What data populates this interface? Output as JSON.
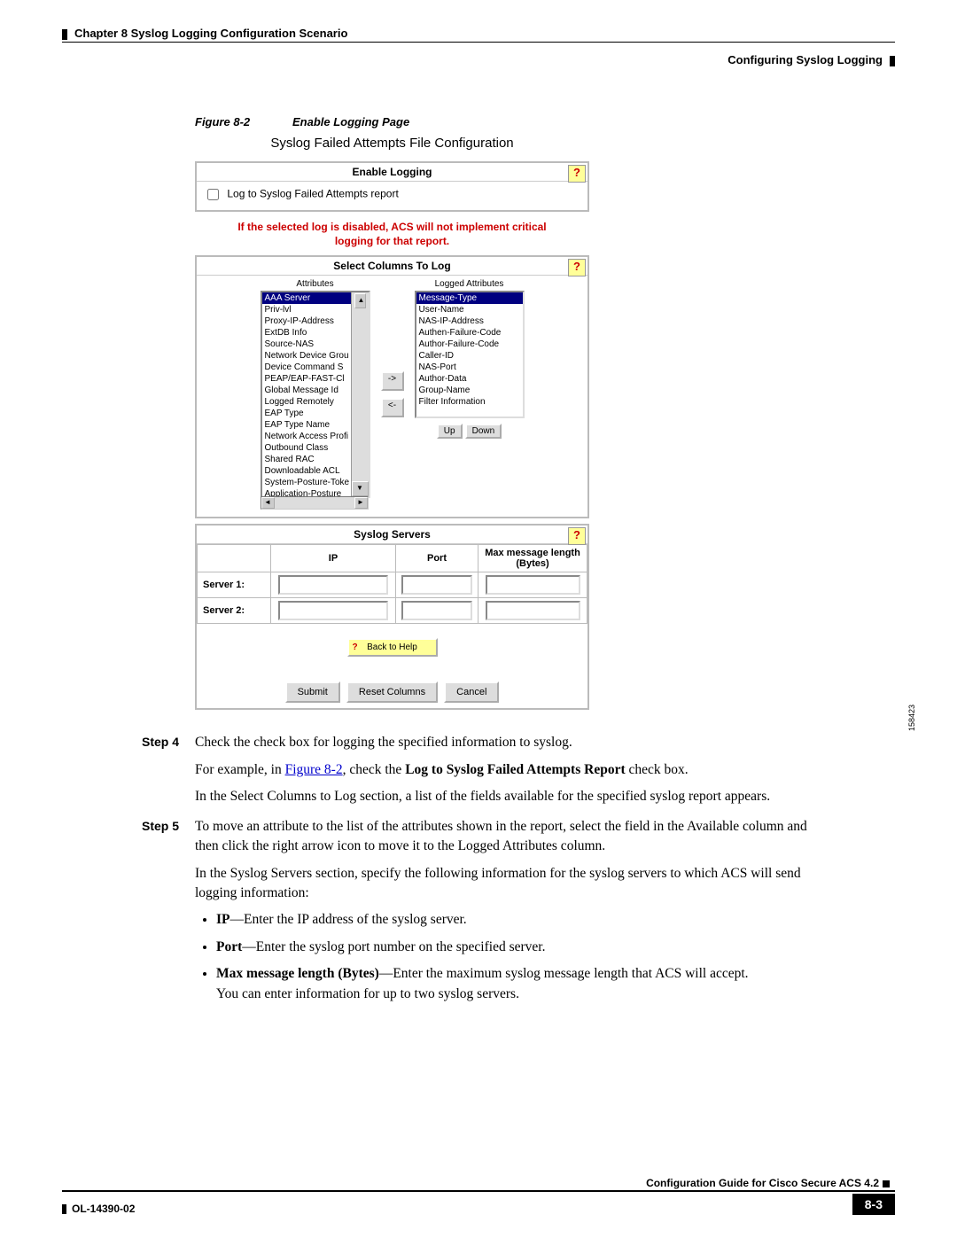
{
  "header": {
    "chapter": "Chapter 8      Syslog Logging Configuration Scenario",
    "section": "Configuring Syslog Logging"
  },
  "figure": {
    "num": "Figure 8-2",
    "title": "Enable Logging Page",
    "id": "158423"
  },
  "screenshot": {
    "title": "Syslog Failed Attempts File Configuration",
    "enable_logging": {
      "header": "Enable Logging",
      "checkbox_label": "Log to Syslog Failed Attempts report",
      "warning": "If the selected log is disabled, ACS will not implement critical logging for that report."
    },
    "select_columns": {
      "header": "Select Columns To Log",
      "attributes_label": "Attributes",
      "logged_label": "Logged Attributes",
      "attributes": [
        "AAA Server",
        "Priv-lvl",
        "Proxy-IP-Address",
        "ExtDB Info",
        "Source-NAS",
        "Network Device Grou",
        "Device Command S",
        "PEAP/EAP-FAST-Cl",
        "Global Message Id",
        "Logged Remotely",
        "EAP Type",
        "EAP Type Name",
        "Network Access Profi",
        "Outbound Class",
        "Shared RAC",
        "Downloadable ACL",
        "System-Posture-Toke",
        "Application-Posture"
      ],
      "logged": [
        "Message-Type",
        "User-Name",
        "NAS-IP-Address",
        "Authen-Failure-Code",
        "Author-Failure-Code",
        "Caller-ID",
        "NAS-Port",
        "Author-Data",
        "Group-Name",
        "Filter Information"
      ],
      "move_right": "->",
      "move_left": "<-",
      "up": "Up",
      "down": "Down"
    },
    "servers": {
      "header": "Syslog Servers",
      "cols": {
        "ip": "IP",
        "port": "Port",
        "max": "Max message length (Bytes)"
      },
      "rows": [
        "Server 1:",
        "Server 2:"
      ]
    },
    "back_help": "Back to Help",
    "buttons": {
      "submit": "Submit",
      "reset": "Reset Columns",
      "cancel": "Cancel"
    }
  },
  "steps": {
    "s4": {
      "label": "Step 4",
      "p1": "Check the check box for logging the specified information to syslog.",
      "p2a": "For example, in ",
      "p2link": "Figure 8-2",
      "p2b": ", check the ",
      "p2bold": "Log to Syslog Failed Attempts Report",
      "p2c": " check box.",
      "p3": "In the Select Columns to Log section, a list of the fields available for the specified syslog report appears."
    },
    "s5": {
      "label": "Step 5",
      "p1": "To move an attribute to the list of the attributes shown in the report, select the field in the Available column and then click the right arrow icon to move it to the Logged Attributes column.",
      "p2": "In the Syslog Servers section, specify the following information for the syslog servers to which ACS will send logging information:",
      "b1a": "IP",
      "b1b": "—Enter the IP address of the syslog server.",
      "b2a": "Port",
      "b2b": "—Enter the syslog port number on the specified server.",
      "b3a": "Max message length (Bytes)",
      "b3b": "—Enter the maximum syslog message length that ACS will accept.",
      "p3": "You can enter information for up to two syslog servers."
    }
  },
  "footer": {
    "title": "Configuration Guide for Cisco Secure ACS 4.2",
    "ol": "OL-14390-02",
    "page": "8-3"
  }
}
